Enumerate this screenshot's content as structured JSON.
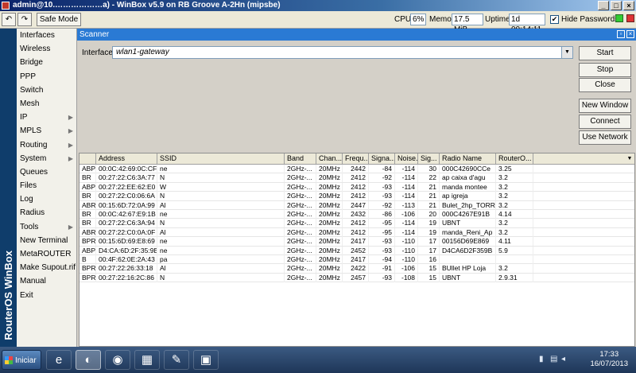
{
  "window": {
    "title": "admin@10.………………a) - WinBox v5.9 on RB Groove A-2Hn (mipsbe)",
    "buttons": [
      "_",
      "□",
      "×"
    ]
  },
  "toolbar": {
    "undo": "↶",
    "redo": "↷",
    "safe_mode": "Safe Mode",
    "cpu_label": "CPU:",
    "cpu_value": "6%",
    "memory_label": "Memory:",
    "memory_value": "17.5 MiB",
    "uptime_label": "Uptime:",
    "uptime_value": "1d 00:14:11",
    "hide_passwords": "Hide Passwords",
    "hide_passwords_checked": true
  },
  "sidebar": {
    "brand": "RouterOS WinBox",
    "items": [
      {
        "label": "Interfaces",
        "arrow": false
      },
      {
        "label": "Wireless",
        "arrow": false
      },
      {
        "label": "Bridge",
        "arrow": false
      },
      {
        "label": "PPP",
        "arrow": false
      },
      {
        "label": "Switch",
        "arrow": false
      },
      {
        "label": "Mesh",
        "arrow": false
      },
      {
        "label": "IP",
        "arrow": true
      },
      {
        "label": "MPLS",
        "arrow": true
      },
      {
        "label": "Routing",
        "arrow": true
      },
      {
        "label": "System",
        "arrow": true
      },
      {
        "label": "Queues",
        "arrow": false
      },
      {
        "label": "Files",
        "arrow": false
      },
      {
        "label": "Log",
        "arrow": false
      },
      {
        "label": "Radius",
        "arrow": false
      },
      {
        "label": "Tools",
        "arrow": true
      },
      {
        "label": "New Terminal",
        "arrow": false
      },
      {
        "label": "MetaROUTER",
        "arrow": false
      },
      {
        "label": "Make Supout.rif",
        "arrow": false
      },
      {
        "label": "Manual",
        "arrow": false
      },
      {
        "label": "Exit",
        "arrow": false
      }
    ]
  },
  "scanner": {
    "title": "Scanner",
    "interface_label": "Interface:",
    "interface_value": "wlan1-gateway",
    "buttons": {
      "start": "Start",
      "stop": "Stop",
      "close": "Close",
      "new_window": "New Window",
      "connect": "Connect",
      "use_network": "Use Network"
    },
    "columns": [
      "",
      "Address",
      "SSID",
      "Band",
      "Chan...",
      "Frequ...",
      "Signa...",
      "Noise...",
      "Sig...",
      "Radio Name",
      "RouterO..."
    ],
    "rows": [
      [
        "ABP",
        "00:0C:42:69:0C:CF",
        "ne",
        "2GHz-...",
        "20MHz",
        "2442",
        "-84",
        "-114",
        "30",
        "000C42690CCe",
        "3.25"
      ],
      [
        "BR",
        "00:27:22:C6:3A:77",
        "N",
        "2GHz-...",
        "20MHz",
        "2412",
        "-92",
        "-114",
        "22",
        "ap caixa d'agu",
        "3.2"
      ],
      [
        "ABP",
        "00:27:22:EE:62:E0",
        "W",
        "2GHz-...",
        "20MHz",
        "2412",
        "-93",
        "-114",
        "21",
        "manda montee",
        "3.2"
      ],
      [
        "BR",
        "00:27:22:C0:06:6A",
        "N",
        "2GHz-...",
        "20MHz",
        "2412",
        "-93",
        "-114",
        "21",
        "ap igreja",
        "3.2"
      ],
      [
        "ABR",
        "00:15:6D:72:0A:99",
        "Al",
        "2GHz-...",
        "20MHz",
        "2447",
        "-92",
        "-113",
        "21",
        "Bulet_2hp_TORR",
        "3.2"
      ],
      [
        "BR",
        "00:0C:42:67:E9:1B",
        "ne",
        "2GHz-...",
        "20MHz",
        "2432",
        "-86",
        "-106",
        "20",
        "000C4267E91B",
        "4.14"
      ],
      [
        "BR",
        "00:27:22:C6:3A:94",
        "N",
        "2GHz-...",
        "20MHz",
        "2412",
        "-95",
        "-114",
        "19",
        "UBNT",
        "3.2"
      ],
      [
        "ABR",
        "00:27:22:C0:0A:0F",
        "Al",
        "2GHz-...",
        "20MHz",
        "2412",
        "-95",
        "-114",
        "19",
        "manda_Reni_Ap",
        "3.2"
      ],
      [
        "BPR",
        "00:15:6D:69:E8:69",
        "ne",
        "2GHz-...",
        "20MHz",
        "2417",
        "-93",
        "-110",
        "17",
        "00156D69E869",
        "4.11"
      ],
      [
        "ABP",
        "D4:CA:6D:2F:35:9B",
        "ne",
        "2GHz-...",
        "20MHz",
        "2452",
        "-93",
        "-110",
        "17",
        "D4CA6D2F359B",
        "5.9"
      ],
      [
        "B",
        "00:4F:62:0E:2A:43",
        "pa",
        "2GHz-...",
        "20MHz",
        "2417",
        "-94",
        "-110",
        "16",
        "",
        ""
      ],
      [
        "BPR",
        "00:27:22:26:33:18",
        "Al",
        "2GHz-...",
        "20MHz",
        "2422",
        "-91",
        "-106",
        "15",
        "BUllet HP Loja",
        "3.2"
      ],
      [
        "BPR",
        "00:27:22:16:2C:86",
        "N",
        "2GHz-...",
        "20MHz",
        "2457",
        "-93",
        "-108",
        "15",
        "UBNT",
        "2.9.31"
      ]
    ]
  },
  "taskbar": {
    "start_label": "Iniciar",
    "time": "17:33",
    "date": "16/07/2013"
  }
}
